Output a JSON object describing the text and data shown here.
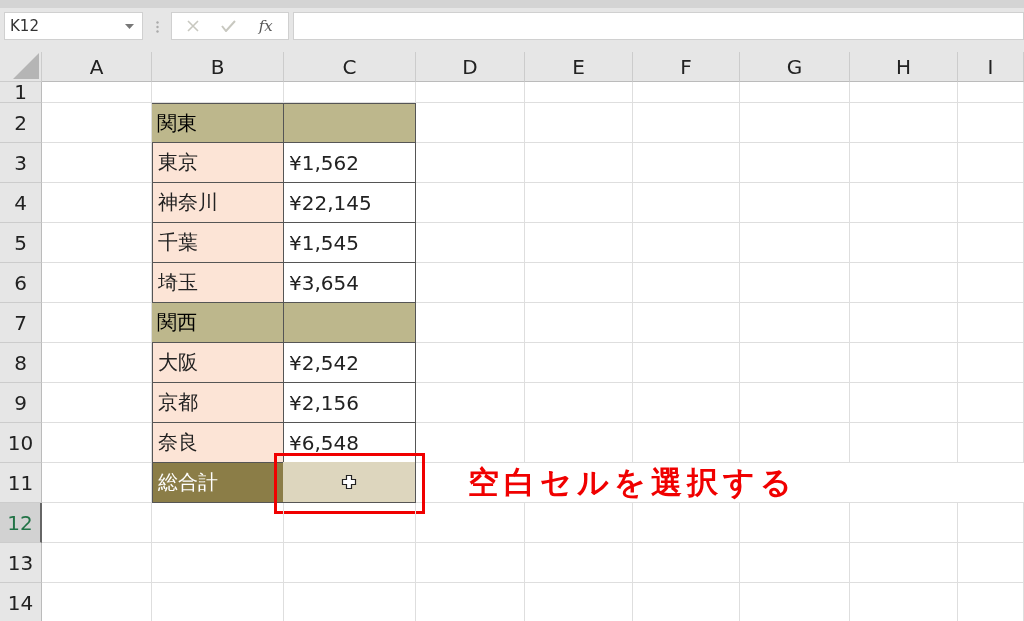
{
  "name_box": {
    "value": "K12"
  },
  "formula_bar": {
    "fx_label": "fx"
  },
  "columns": [
    {
      "label": "A"
    },
    {
      "label": "B"
    },
    {
      "label": "C"
    },
    {
      "label": "D"
    },
    {
      "label": "E"
    },
    {
      "label": "F"
    },
    {
      "label": "G"
    },
    {
      "label": "H"
    },
    {
      "label": "I"
    }
  ],
  "rows": [
    {
      "label": "1",
      "selected": false,
      "kind": "empty"
    },
    {
      "label": "2",
      "selected": false,
      "kind": "section",
      "b": "関東"
    },
    {
      "label": "3",
      "selected": false,
      "kind": "item",
      "b": "東京",
      "c": "¥1,562"
    },
    {
      "label": "4",
      "selected": false,
      "kind": "item",
      "b": "神奈川",
      "c": "¥22,145"
    },
    {
      "label": "5",
      "selected": false,
      "kind": "item",
      "b": "千葉",
      "c": "¥1,545"
    },
    {
      "label": "6",
      "selected": false,
      "kind": "item",
      "b": "埼玉",
      "c": "¥3,654"
    },
    {
      "label": "7",
      "selected": false,
      "kind": "section",
      "b": "関西"
    },
    {
      "label": "8",
      "selected": false,
      "kind": "item",
      "b": "大阪",
      "c": "¥2,542"
    },
    {
      "label": "9",
      "selected": false,
      "kind": "item",
      "b": "京都",
      "c": "¥2,156"
    },
    {
      "label": "10",
      "selected": false,
      "kind": "item",
      "b": "奈良",
      "c": "¥6,548"
    },
    {
      "label": "11",
      "selected": false,
      "kind": "total",
      "b": "総合計"
    },
    {
      "label": "12",
      "selected": true,
      "kind": "empty"
    },
    {
      "label": "13",
      "selected": false,
      "kind": "empty"
    },
    {
      "label": "14",
      "selected": false,
      "kind": "empty"
    }
  ],
  "annotation": {
    "text": "空白セルを選択する"
  }
}
